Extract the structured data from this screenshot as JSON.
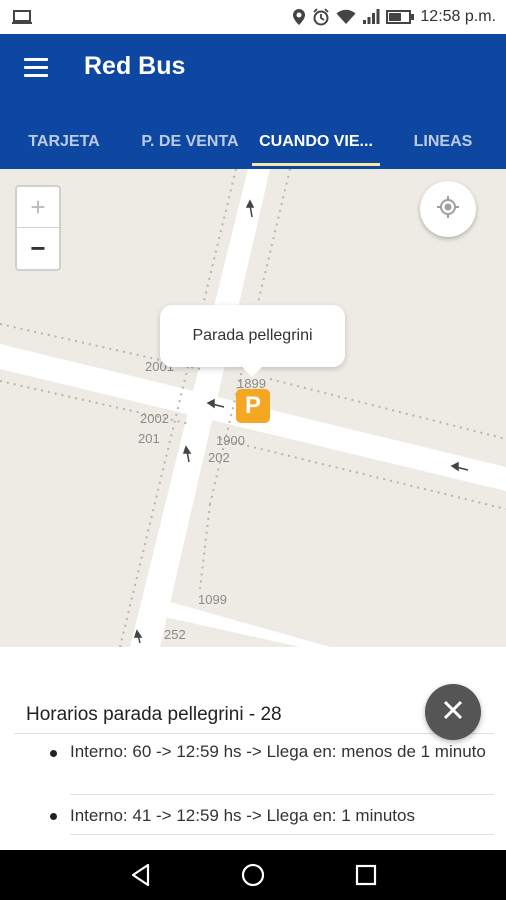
{
  "status_bar": {
    "time": "12:58 p.m."
  },
  "app": {
    "title": "Red Bus"
  },
  "tabs": [
    {
      "label": "TARJETA"
    },
    {
      "label": "P. DE VENTA"
    },
    {
      "label": "CUANDO VIE..."
    },
    {
      "label": "LINEAS"
    }
  ],
  "active_tab": "CUANDO VIE...",
  "map": {
    "zoom_in": "+",
    "zoom_out": "−",
    "popup_text": "Parada pellegrini",
    "marker_letter": "P",
    "labels": [
      "2001",
      "1899",
      "2002",
      "201",
      "1900",
      "202",
      "1099",
      "252"
    ]
  },
  "schedule": {
    "title": "Horarios parada pellegrini - 28",
    "items": [
      {
        "text": "Interno: 60 -> 12:59 hs -> Llega en: menos de 1 minuto"
      },
      {
        "text": "Interno: 41 -> 12:59 hs -> Llega en: 1 minutos"
      }
    ]
  },
  "colors": {
    "app_bar": "#0d47a1",
    "tab_indicator": "#f6e7a5",
    "marker": "#f5a623",
    "fab": "#555555"
  },
  "icons": [
    "menu-icon",
    "location-icon",
    "alarm-icon",
    "wifi-icon",
    "signal-icon",
    "battery-icon",
    "gps-target-icon",
    "close-icon",
    "back-icon",
    "home-icon",
    "recents-icon"
  ]
}
